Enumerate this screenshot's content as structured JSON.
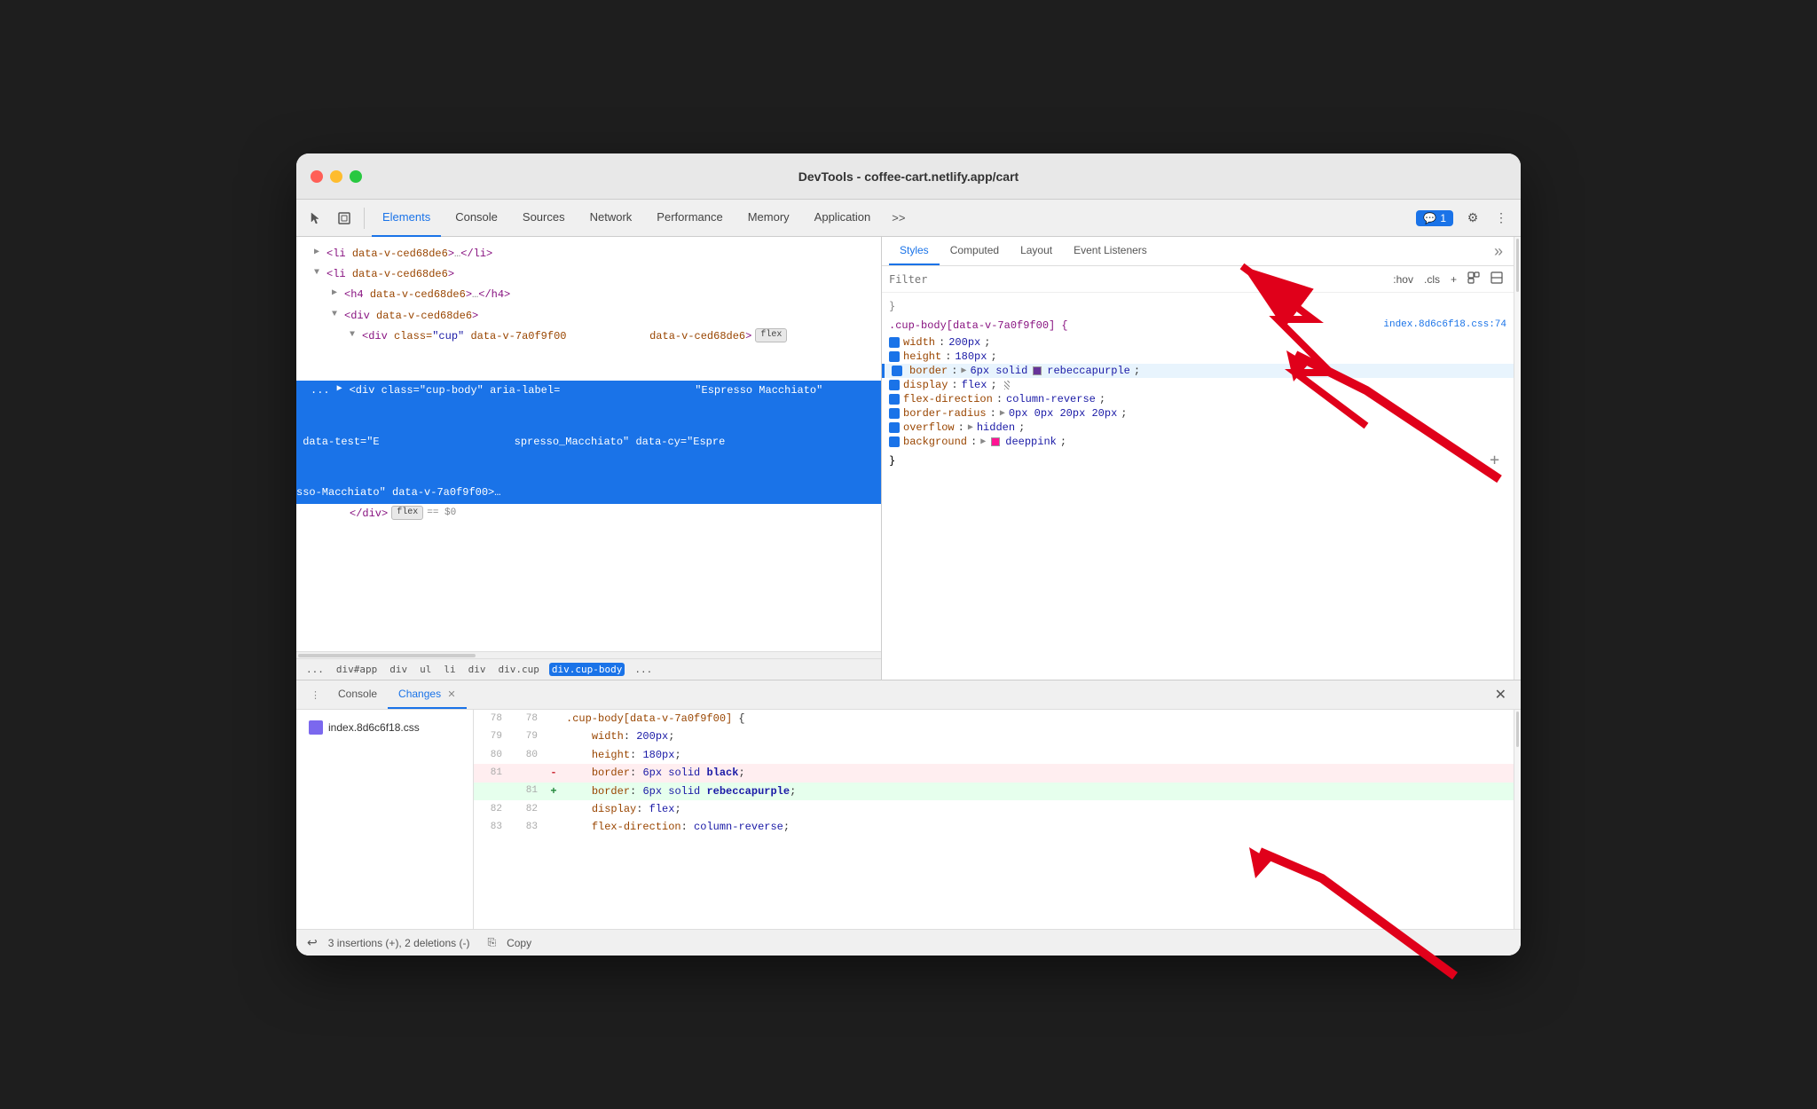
{
  "window": {
    "title": "DevTools - coffee-cart.netlify.app/cart"
  },
  "toolbar": {
    "tabs": [
      "Elements",
      "Console",
      "Sources",
      "Network",
      "Performance",
      "Memory",
      "Application"
    ],
    "active_tab": "Elements",
    "chat_badge": "1",
    "more_tabs": ">>"
  },
  "elements": {
    "lines": [
      {
        "indent": 0,
        "arrow": "▶",
        "content": "<li data-v-ced68de6>…</li>"
      },
      {
        "indent": 0,
        "arrow": "▼",
        "content": "<li data-v-ced68de6>"
      },
      {
        "indent": 1,
        "arrow": "▶",
        "content": "<h4 data-v-ced68de6>…</h4>"
      },
      {
        "indent": 1,
        "arrow": "▼",
        "content": "<div data-v-ced68de6>"
      },
      {
        "indent": 2,
        "arrow": "▼",
        "content": "<div class=\"cup\" data-v-7a0f9f00 data-v-ced68de6>",
        "badge": "flex"
      },
      {
        "indent": 3,
        "arrow": "▶",
        "content": "<div class=\"cup-body\" aria-label=\"Espresso Macchiato\" data-test=\"Espresso_Macchiato\" data-cy=\"Espresso-Macchiato\" data-v-7a0f9f00>…",
        "selected": true
      },
      {
        "indent": 3,
        "arrow": "",
        "content": "</div>",
        "badge": "flex",
        "equals": "== $0"
      }
    ]
  },
  "breadcrumb": {
    "items": [
      "...",
      "div#app",
      "div",
      "ul",
      "li",
      "div",
      "div.cup",
      "div.cup-body",
      "..."
    ],
    "active_index": 7
  },
  "styles_panel": {
    "tabs": [
      "Styles",
      "Computed",
      "Layout",
      "Event Listeners"
    ],
    "active_tab": "Styles",
    "filter_placeholder": "Filter",
    "hov_label": ":hov",
    "cls_label": ".cls",
    "rule": {
      "selector": ".cup-body[data-v-7a0f9f00] {",
      "source": "index.8d6c6f18.css:74",
      "properties": [
        {
          "name": "width",
          "value": "200px",
          "checked": true
        },
        {
          "name": "height",
          "value": "180px",
          "checked": true
        },
        {
          "name": "border",
          "value": "6px solid",
          "color": "rebeccapurple",
          "color_hex": "#663399",
          "rest": "rebeccapurple",
          "checked": true,
          "highlighted": true
        },
        {
          "name": "display",
          "value": "flex",
          "checked": true
        },
        {
          "name": "flex-direction",
          "value": "column-reverse",
          "checked": true
        },
        {
          "name": "border-radius",
          "value": "0px 0px 20px 20px",
          "checked": true
        },
        {
          "name": "overflow",
          "value": "hidden",
          "checked": true
        },
        {
          "name": "background",
          "value": "deeppink",
          "color": "deeppink",
          "color_hex": "#ff1493",
          "checked": true
        }
      ],
      "close": "}"
    }
  },
  "bottom_panel": {
    "tabs": [
      "Console",
      "Changes"
    ],
    "active_tab": "Changes",
    "files": [
      {
        "name": "index.8d6c6f18.css"
      }
    ],
    "diff": {
      "lines": [
        {
          "old": "78",
          "new": "78",
          "sign": "",
          "text": ".cup-body[data-v-7a0f9f00] {",
          "type": "neutral"
        },
        {
          "old": "79",
          "new": "79",
          "sign": "",
          "text": "    width: 200px;",
          "type": "neutral"
        },
        {
          "old": "80",
          "new": "80",
          "sign": "",
          "text": "    height: 180px;",
          "type": "neutral"
        },
        {
          "old": "81",
          "new": "",
          "sign": "-",
          "text": "    border: 6px solid black;",
          "type": "removed",
          "highlight_word": "black"
        },
        {
          "old": "",
          "new": "81",
          "sign": "+",
          "text": "    border: 6px solid rebeccapurple;",
          "type": "added",
          "highlight_word": "rebeccapurple"
        },
        {
          "old": "82",
          "new": "82",
          "sign": "",
          "text": "    display: flex;",
          "type": "neutral"
        },
        {
          "old": "83",
          "new": "83",
          "sign": "",
          "text": "    flex-direction: column-reverse;",
          "type": "neutral"
        }
      ]
    },
    "summary": "3 insertions (+), 2 deletions (-)",
    "copy_label": "Copy"
  },
  "icons": {
    "cursor": "⬡",
    "inspector": "□",
    "more": "≫",
    "gear": "⚙",
    "kebab": "⋮",
    "plus_icon": "+",
    "copy_icon": "⎘",
    "undo_icon": "↩",
    "copy_small": "⎘"
  }
}
